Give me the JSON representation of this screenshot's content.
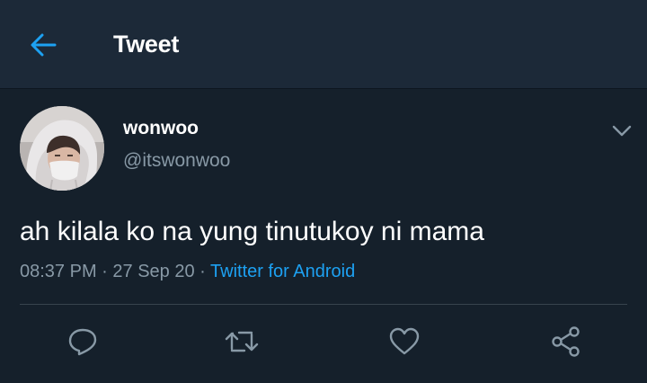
{
  "header": {
    "title": "Tweet",
    "back_icon": "arrow-left-icon"
  },
  "tweet": {
    "display_name": "wonwoo",
    "handle": "@itswonwoo",
    "text": "ah kilala ko na yung tinutukoy ni mama",
    "time": "08:37 PM",
    "separator": " · ",
    "date": "27 Sep 20",
    "source": "Twitter for Android"
  },
  "actions": [
    "reply-icon",
    "retweet-icon",
    "like-icon",
    "share-icon"
  ],
  "colors": {
    "background": "#15202b",
    "header_background": "#1c2938",
    "accent": "#1da1f2",
    "secondary_text": "#8899a6",
    "divider": "#38444d"
  }
}
